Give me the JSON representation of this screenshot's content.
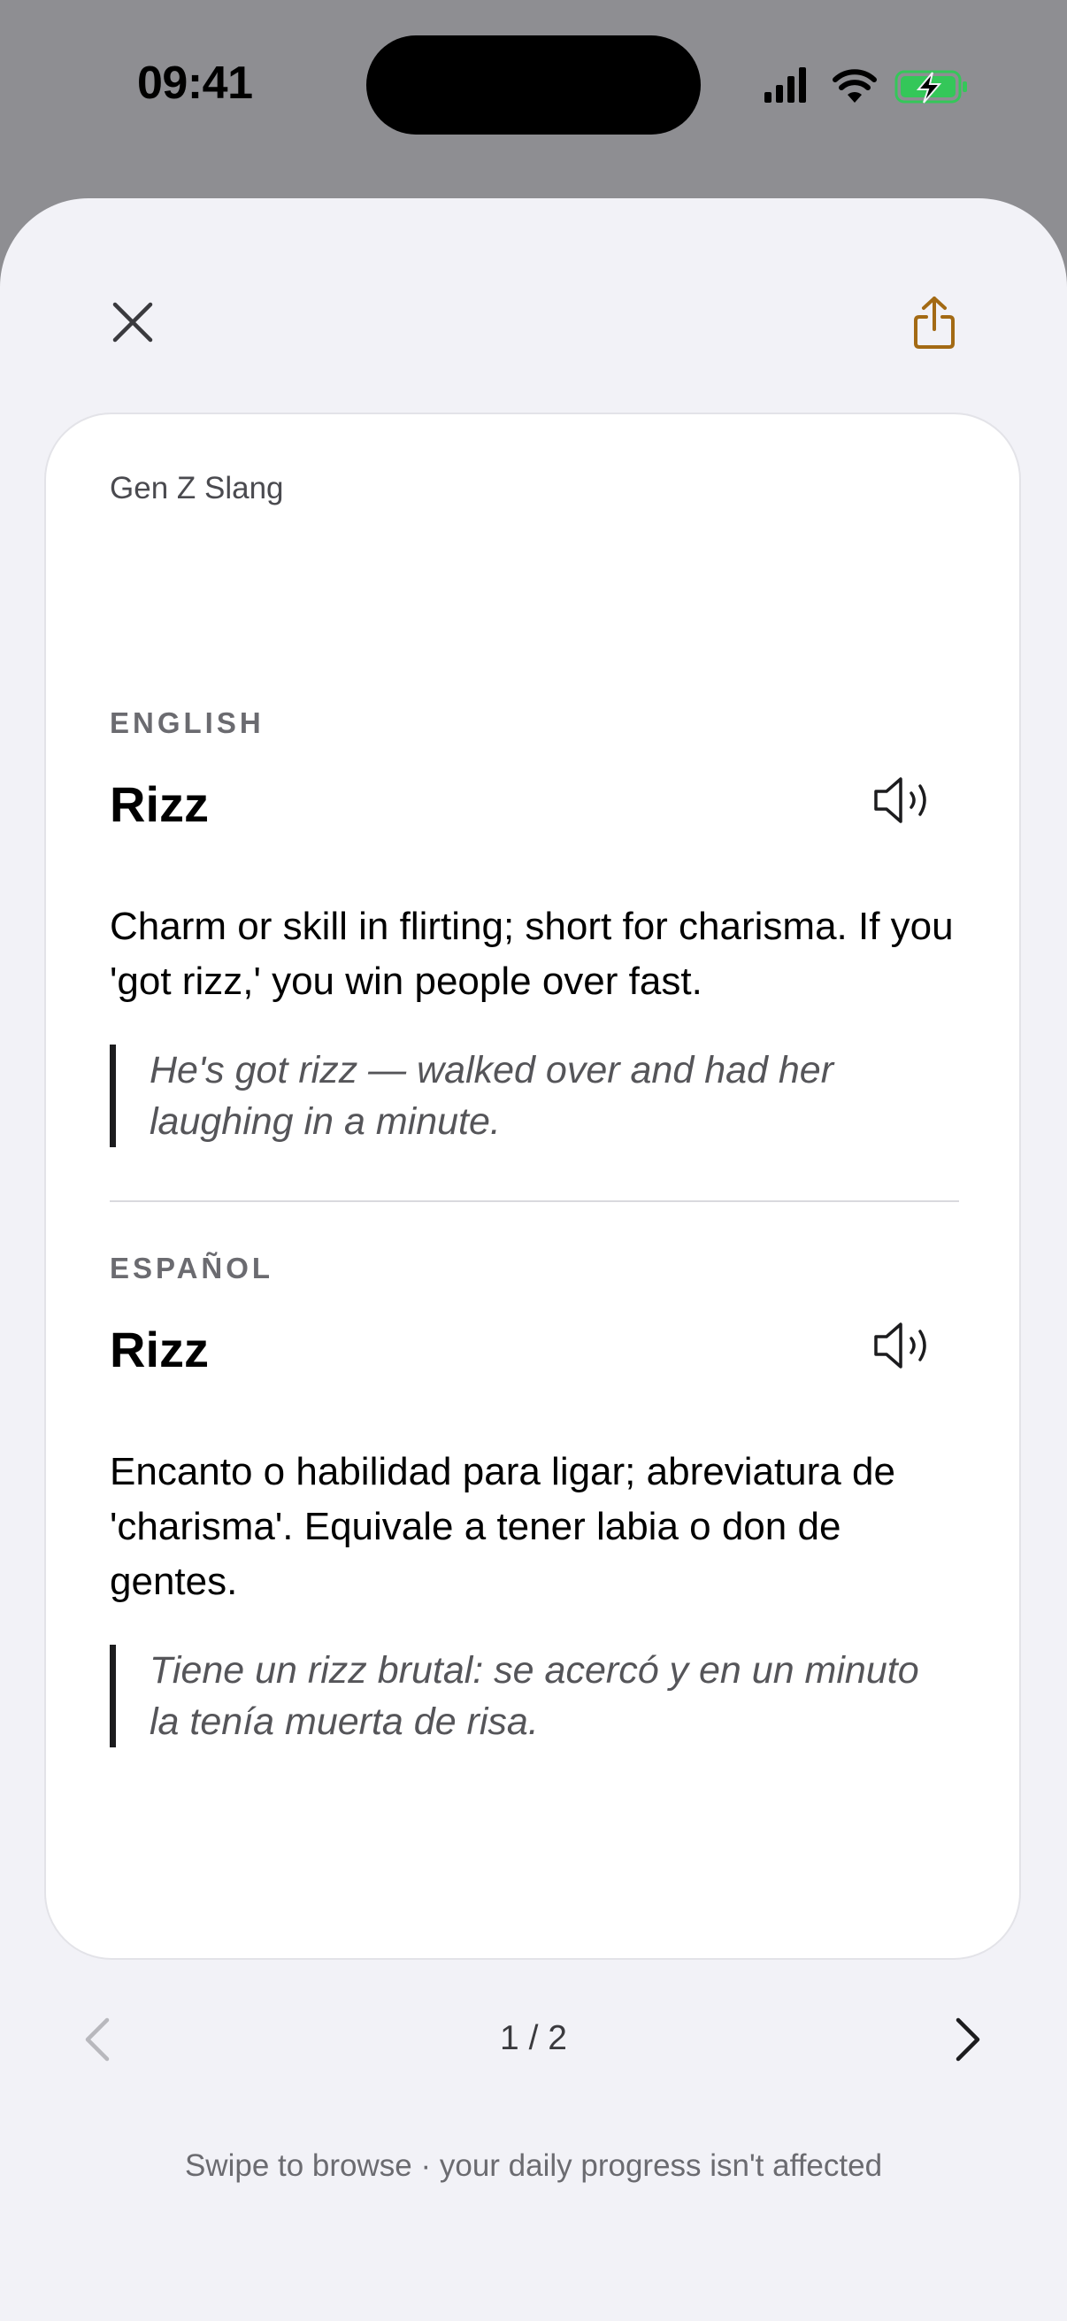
{
  "status_bar": {
    "time": "09:41"
  },
  "card": {
    "deck_name": "Gen Z Slang",
    "english": {
      "label": "ENGLISH",
      "term": "Rizz",
      "definition": "Charm or skill in flirting; short for charisma. If you 'got rizz,' you win people over fast.",
      "example": "He's got rizz — walked over and had her laughing in a minute."
    },
    "spanish": {
      "label": "ESPAÑOL",
      "term": "Rizz",
      "definition": "Encanto o habilidad para ligar; abreviatura de 'charisma'. Equivale a tener labia o don de gentes.",
      "example": "Tiene un rizz brutal: se acercó y en un minuto la tenía muerta de risa."
    }
  },
  "pager": {
    "indicator": "1 / 2",
    "hint": "Swipe to browse · your daily progress isn't affected"
  },
  "icons": {
    "close": "close-icon",
    "share": "share-icon",
    "speaker": "speaker-icon",
    "prev": "chevron-left-icon",
    "next": "chevron-right-icon"
  },
  "colors": {
    "accent": "#a36a14",
    "battery": "#34c759",
    "sheet_background": "#f2f2f7",
    "card_background": "#ffffff"
  }
}
